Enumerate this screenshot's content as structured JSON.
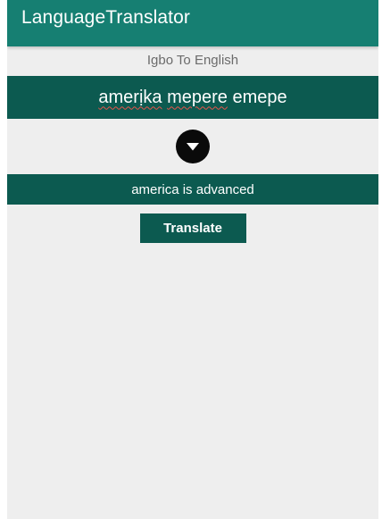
{
  "app_bar": {
    "title": "LanguageTranslator"
  },
  "mode_label": "Igbo To English",
  "input": {
    "words": [
      "amerịka",
      "mepere",
      "emepe"
    ]
  },
  "swap_button": {
    "icon": "caret-down-icon"
  },
  "output": {
    "text": "america is advanced"
  },
  "translate_button": {
    "label": "Translate"
  },
  "colors": {
    "app_bar": "#167f72",
    "panel": "#0c5a50",
    "background": "#eeeeee",
    "swap_button": "#0a0a0a"
  }
}
